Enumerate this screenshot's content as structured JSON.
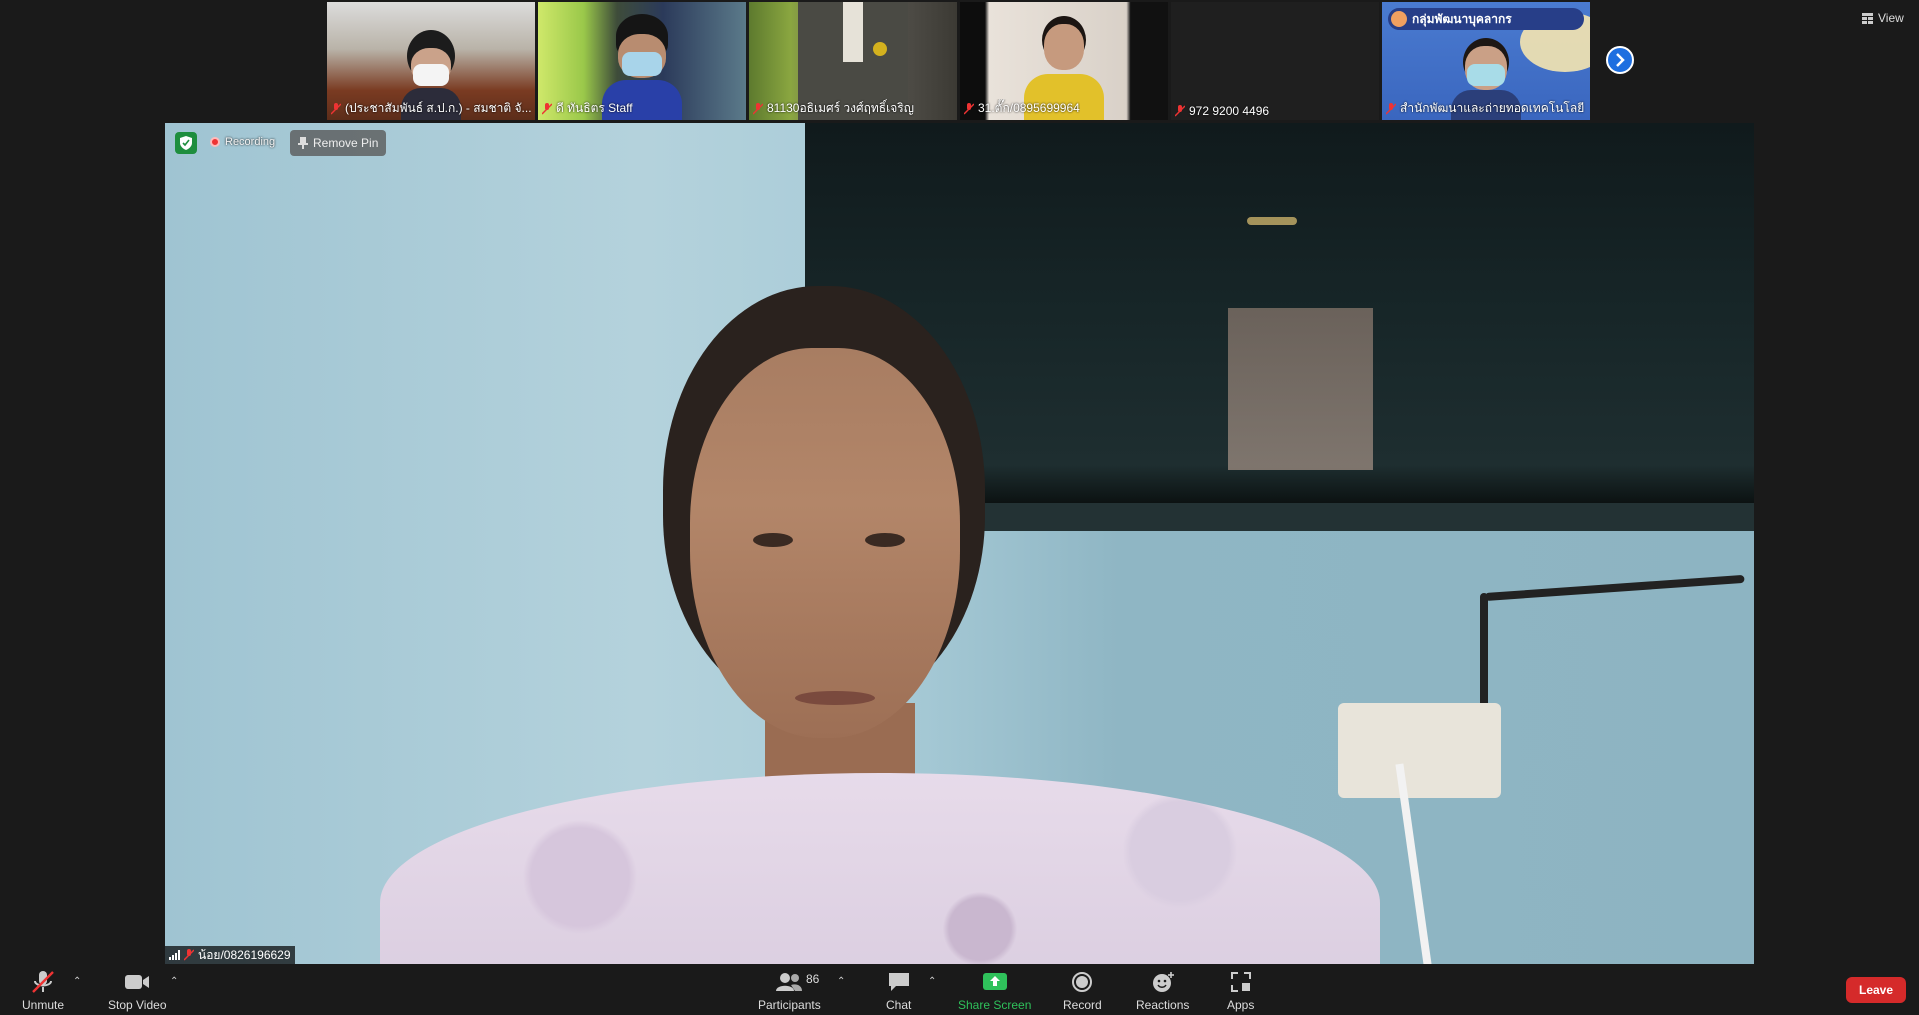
{
  "strip": {
    "tiles": [
      {
        "name": "(ประชาสัมพันธ์ ส.ป.ก.) - สมชาติ จั..."
      },
      {
        "name": "ดี ทันธิตร Staff"
      },
      {
        "name": "81130อธิเมศร์ วงศ์ฤทธิ์เจริญ"
      },
      {
        "name": "31.ตั๊ก/0895699964"
      },
      {
        "name": "972 9200 4496"
      },
      {
        "name": "สำนักพัฒนาและถ่ายทอดเทคโนโลยี ...",
        "banner": "กลุ่มพัฒนาบุคลากร"
      }
    ]
  },
  "view": {
    "label": "View"
  },
  "main": {
    "recording_label": "Recording",
    "remove_pin_label": "Remove Pin",
    "speaker_name": "น้อย/0826196629"
  },
  "toolbar": {
    "unmute": "Unmute",
    "stop_video": "Stop Video",
    "participants": "Participants",
    "participants_count": "86",
    "chat": "Chat",
    "share_screen": "Share Screen",
    "record": "Record",
    "reactions": "Reactions",
    "apps": "Apps",
    "leave": "Leave"
  },
  "colors": {
    "leave": "#d52a2a",
    "share": "#2fc15b",
    "accent": "#1e6fe0"
  }
}
